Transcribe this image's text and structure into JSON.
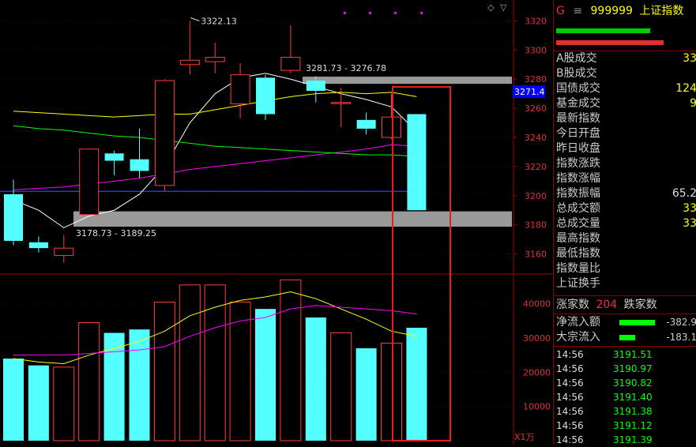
{
  "header": {
    "g_label": "G",
    "menu_glyph": "≡",
    "code": "999999",
    "name": "上证指数"
  },
  "indicator_bars": [
    {
      "color": "#00cc00",
      "frac": 0.7
    },
    {
      "color": "#e03030",
      "frac": 0.8
    }
  ],
  "quote_rows": [
    {
      "label": "A股成交",
      "value": "33",
      "color": "#ff0"
    },
    {
      "label": "B股成交",
      "value": "",
      "color": "#ff0"
    },
    {
      "label": "国债成交",
      "value": "124",
      "color": "#ff0"
    },
    {
      "label": "基金成交",
      "value": "9",
      "color": "#ff0"
    },
    {
      "label": "最新指数",
      "value": "",
      "color": "#ff0"
    },
    {
      "label": "今日开盘",
      "value": "",
      "color": "#ff0"
    },
    {
      "label": "昨日收盘",
      "value": "",
      "color": "#ff0"
    },
    {
      "label": "指数涨跌",
      "value": "",
      "color": "#ff0"
    },
    {
      "label": "指数涨幅",
      "value": "",
      "color": "#ff0"
    },
    {
      "label": "指数振幅",
      "value": "65.2",
      "color": "#ddd"
    },
    {
      "label": "总成交额",
      "value": "33",
      "color": "#ff0"
    },
    {
      "label": "总成交量",
      "value": "33",
      "color": "#ff0"
    },
    {
      "label": "最高指数",
      "value": "",
      "color": "#ff0"
    },
    {
      "label": "最低指数",
      "value": "",
      "color": "#ff0"
    },
    {
      "label": "指数量比",
      "value": "",
      "color": "#ff0"
    },
    {
      "label": "上证换手",
      "value": "",
      "color": "#ff0"
    }
  ],
  "breadth": {
    "up_label": "涨家数",
    "up_value": "204",
    "down_label": "跌家数"
  },
  "flows": [
    {
      "label": "净流入额",
      "value": "-382.9",
      "frac": 0.45
    },
    {
      "label": "大宗流入",
      "value": "-183.1",
      "frac": 0.2
    }
  ],
  "ticks": [
    {
      "time": "14:56",
      "price": "3191.51"
    },
    {
      "time": "14:56",
      "price": "3190.97"
    },
    {
      "time": "14:56",
      "price": "3190.82"
    },
    {
      "time": "14:56",
      "price": "3191.40"
    },
    {
      "time": "14:56",
      "price": "3191.38"
    },
    {
      "time": "14:56",
      "price": "3191.12"
    },
    {
      "time": "14:56",
      "price": "3191.39"
    }
  ],
  "chart_data": [
    {
      "type": "candlestick",
      "title": "",
      "ylim": [
        3150,
        3330
      ],
      "yticks": [
        3160,
        3180,
        3200,
        3220,
        3240,
        3260,
        3280,
        3300,
        3320
      ],
      "candles": [
        {
          "o": 3201,
          "c": 3169,
          "h": 3211,
          "l": 3166
        },
        {
          "o": 3168,
          "c": 3164,
          "h": 3172,
          "l": 3161
        },
        {
          "o": 3159,
          "c": 3164,
          "h": 3173,
          "l": 3154
        },
        {
          "o": 3187,
          "c": 3232,
          "h": 3232,
          "l": 3187
        },
        {
          "o": 3229,
          "c": 3224,
          "h": 3231,
          "l": 3214
        },
        {
          "o": 3225,
          "c": 3217,
          "h": 3246,
          "l": 3212
        },
        {
          "o": 3207,
          "c": 3279,
          "h": 3280,
          "l": 3203
        },
        {
          "o": 3290,
          "c": 3293,
          "h": 3320,
          "l": 3283
        },
        {
          "o": 3292,
          "c": 3295,
          "h": 3305,
          "l": 3284
        },
        {
          "o": 3263,
          "c": 3283,
          "h": 3291,
          "l": 3253
        },
        {
          "o": 3281,
          "c": 3256,
          "h": 3283,
          "l": 3252
        },
        {
          "o": 3286,
          "c": 3295,
          "h": 3317,
          "l": 3284
        },
        {
          "o": 3279,
          "c": 3272,
          "h": 3282,
          "l": 3264
        },
        {
          "o": 3264,
          "c": 3264,
          "h": 3274,
          "l": 3247
        },
        {
          "o": 3252,
          "c": 3246,
          "h": 3257,
          "l": 3242
        },
        {
          "o": 3240,
          "c": 3254,
          "h": 3270,
          "l": 3239
        },
        {
          "o": 3256,
          "c": 3190,
          "h": 3256,
          "l": 3190
        }
      ],
      "ma_lines": [
        {
          "name": "MA5",
          "color": "#ffffff",
          "values": [
            3197,
            3190,
            3178,
            3186,
            3190,
            3201,
            3220,
            3250,
            3270,
            3281,
            3284,
            3280,
            3275,
            3270,
            3266,
            3261,
            3244
          ]
        },
        {
          "name": "MA10",
          "color": "#ffff00",
          "values": [
            3258,
            3257,
            3256,
            3255,
            3254,
            3255,
            3256,
            3256,
            3259,
            3262,
            3265,
            3268,
            3270,
            3271,
            3270,
            3271,
            3268
          ]
        },
        {
          "name": "MA20",
          "color": "#ff00ff",
          "values": [
            3204,
            3205,
            3206,
            3208,
            3210,
            3212,
            3215,
            3218,
            3220,
            3222,
            3224,
            3226,
            3228,
            3230,
            3232,
            3235,
            3234
          ]
        },
        {
          "name": "MA60",
          "color": "#00ff00",
          "values": [
            3248,
            3246,
            3245,
            3243,
            3241,
            3240,
            3238,
            3236,
            3234,
            3233,
            3232,
            3231,
            3230,
            3229,
            3228,
            3228,
            3227
          ]
        }
      ],
      "blue_line_value": 3203,
      "zones": [
        {
          "label": "3281.73 - 3276.78",
          "low": 3276.78,
          "high": 3281.73
        },
        {
          "label": "3178.73 - 3189.25",
          "low": 3178.73,
          "high": 3189.25
        }
      ],
      "annotations": [
        {
          "label": "3322.13",
          "value": 3322.13
        }
      ],
      "price_tag": "3271.4"
    },
    {
      "type": "bar",
      "title": "",
      "unit_label": "X1万",
      "ylim": [
        0,
        48000
      ],
      "yticks": [
        10000,
        20000,
        30000,
        40000
      ],
      "values": [
        24000,
        22000,
        21500,
        34500,
        31500,
        32500,
        40500,
        45500,
        45500,
        40500,
        38500,
        47000,
        36000,
        31500,
        27000,
        28500,
        33000
      ],
      "ma_lines": [
        {
          "name": "MA5",
          "color": "#ffff00",
          "values": [
            24000,
            23000,
            22500,
            25000,
            27000,
            29000,
            32000,
            36500,
            39000,
            41000,
            42000,
            43500,
            41500,
            38500,
            35500,
            32000,
            30500
          ]
        },
        {
          "name": "MA10",
          "color": "#ff00ff",
          "values": [
            25000,
            25000,
            25000,
            25500,
            26000,
            26500,
            27500,
            30500,
            33000,
            35000,
            36000,
            38500,
            39500,
            39000,
            38500,
            38000,
            37000
          ]
        }
      ]
    }
  ]
}
